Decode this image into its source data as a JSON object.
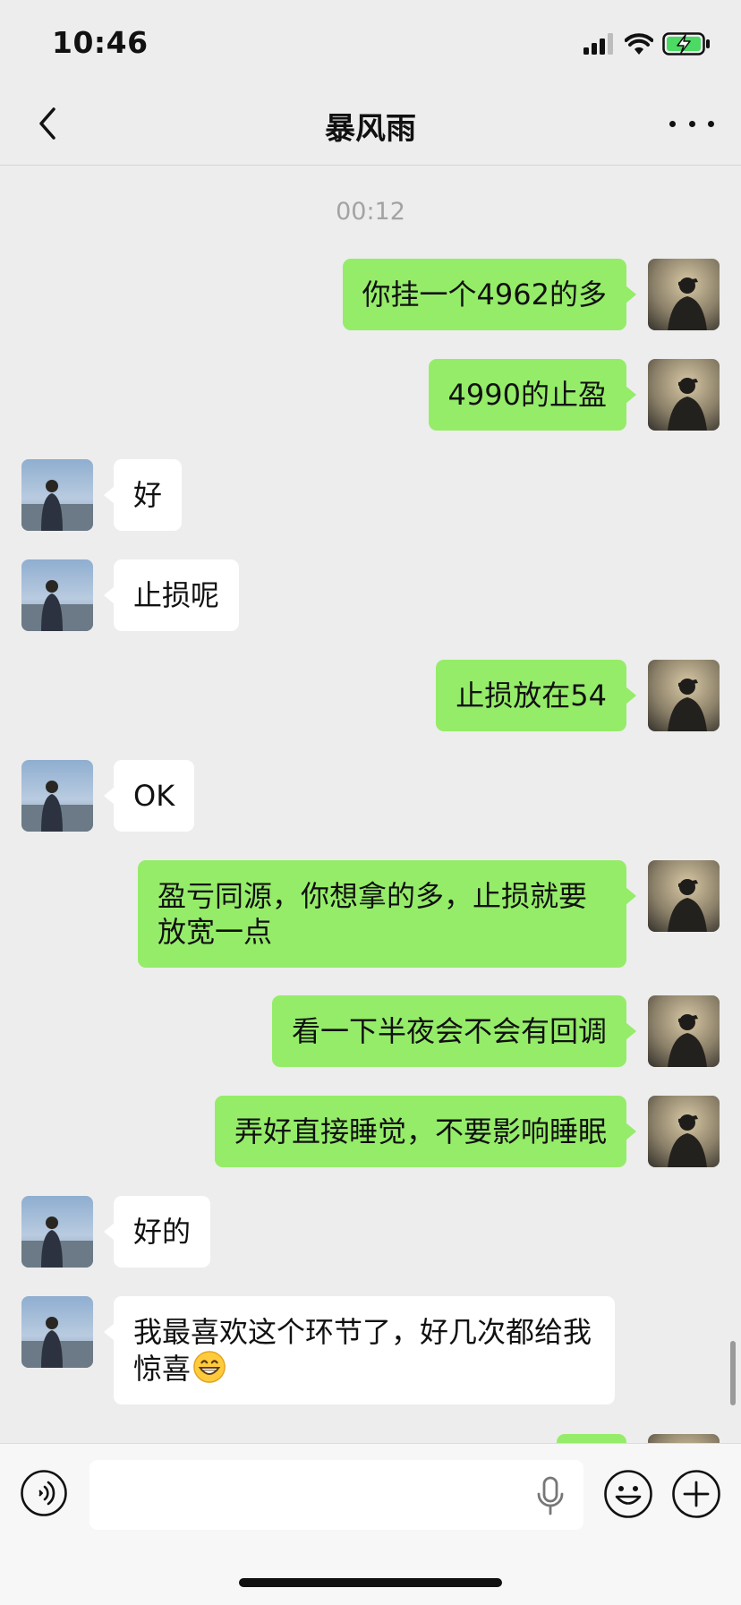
{
  "status_bar": {
    "time": "10:46"
  },
  "header": {
    "title": "暴风雨"
  },
  "chat": {
    "timestamp": "00:12",
    "messages": [
      {
        "side": "me",
        "text": "你挂一个4962的多"
      },
      {
        "side": "me",
        "text": "4990的止盈"
      },
      {
        "side": "other",
        "text": "好"
      },
      {
        "side": "other",
        "text": "止损呢"
      },
      {
        "side": "me",
        "text": "止损放在54"
      },
      {
        "side": "other",
        "text": "OK"
      },
      {
        "side": "me",
        "text": "盈亏同源，你想拿的多，止损就要放宽一点"
      },
      {
        "side": "me",
        "text": "看一下半夜会不会有回调"
      },
      {
        "side": "me",
        "text": "弄好直接睡觉，不要影响睡眠"
      },
      {
        "side": "other",
        "text": "好的"
      },
      {
        "side": "other",
        "text": "我最喜欢这个环节了，好几次都给我惊喜",
        "emoji": "grinning-face-emoji"
      }
    ]
  },
  "colors": {
    "sent_bubble": "#95ec69",
    "received_bubble": "#ffffff",
    "chat_background": "#ededed",
    "battery_charging": "#4cd964"
  },
  "input_bar": {
    "value": ""
  }
}
